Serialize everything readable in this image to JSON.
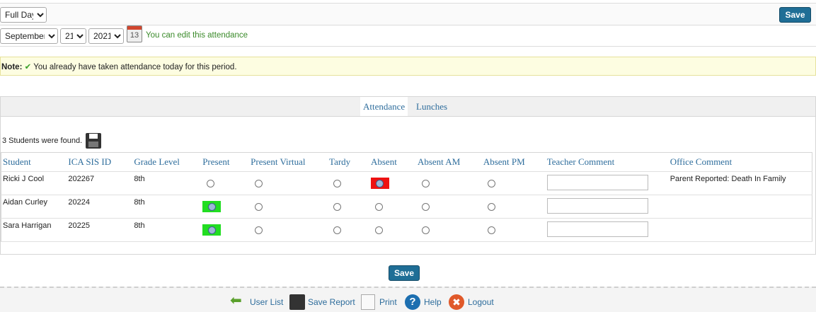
{
  "toolbar": {
    "period_value": "Full Day",
    "save_label": "Save"
  },
  "date": {
    "month": "September",
    "day": "21",
    "year": "2021",
    "calendar_day": "13",
    "edit_message": "You can edit this attendance"
  },
  "note": {
    "label": "Note",
    "message": "You already have taken attendance today for this period."
  },
  "tabs": [
    {
      "label": "Attendance",
      "active": true
    },
    {
      "label": "Lunches",
      "active": false
    }
  ],
  "students_found": "3 Students were found.",
  "table": {
    "headers": [
      "Student",
      "ICA SIS ID",
      "Grade Level",
      "Present",
      "Present Virtual",
      "Tardy",
      "Absent",
      "Absent AM",
      "Absent PM",
      "Teacher Comment",
      "Office Comment"
    ],
    "rows": [
      {
        "name": "Ricki J Cool",
        "id": "202267",
        "grade": "8th",
        "selected": "Absent",
        "office_comment": "Parent Reported: Death In Family"
      },
      {
        "name": "Aidan Curley",
        "id": "20224",
        "grade": "8th",
        "selected": "Present",
        "office_comment": ""
      },
      {
        "name": "Sara Harrigan",
        "id": "20225",
        "grade": "8th",
        "selected": "Present",
        "office_comment": ""
      }
    ]
  },
  "bottom_save_label": "Save",
  "footer": {
    "user_list": "User List",
    "save_report": "Save Report",
    "print": "Print",
    "help": "Help",
    "logout": "Logout"
  },
  "colors": {
    "present_highlight": "#22dd22",
    "absent_highlight": "#ee1111",
    "link": "#2e6d9c",
    "save_button": "#1f6e96"
  }
}
